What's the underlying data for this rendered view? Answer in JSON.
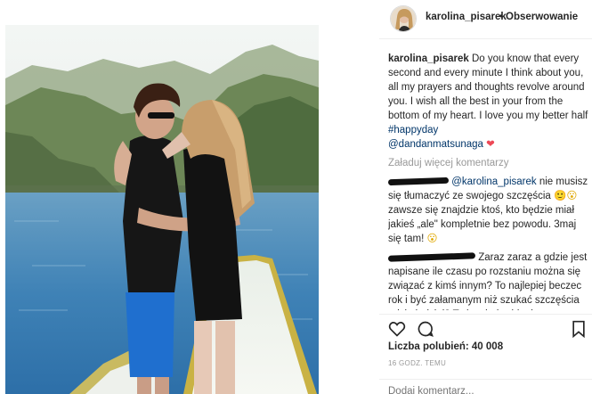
{
  "post": {
    "username": "karolina_pisarek",
    "separator": "•",
    "follow_label": "Obserwowanie",
    "caption_user": "karolina_pisarek",
    "caption_text": "Do you know that every second and every minute I think about you, all my prayers and thoughts revolve around you. I wish all the best in your from the bottom of my heart. I love you my better half",
    "hashtag": "#happyday",
    "mention": "@dandanmatsunaga",
    "heart": "❤",
    "load_more": "Załaduj więcej komentarzy",
    "comments": [
      {
        "mention": "@karolina_pisarek",
        "text": "nie musisz się tłumaczyć ze swojego szczęścia",
        "emoji1": "🙂😮",
        "text2": "zawsze się znajdzie ktoś, kto będzie miał jakieś „ale\" kompletnie bez powodu. 3maj się tam!",
        "emoji2": "😮"
      },
      {
        "text": "Zaraz zaraz a gdzie jest napisane ile czasu po rozstaniu można się związać z kimś innym? To najlepiej beczec rok i być załamanym niż szukać szczęścia gdzie indziej? To jest indywidualna sprawa każdego człowieka. Ja"
      }
    ],
    "likes": "Liczba polubień: 40 008",
    "time": "16 GODZ. TEMU",
    "add_comment_placeholder": "Dodaj komentarz..."
  },
  "icons": {
    "like": "heart-outline-icon",
    "comment": "speech-bubble-icon",
    "save": "bookmark-icon"
  },
  "colors": {
    "link": "#003569",
    "muted": "#999999",
    "text": "#262626",
    "heart": "#ed4956"
  }
}
